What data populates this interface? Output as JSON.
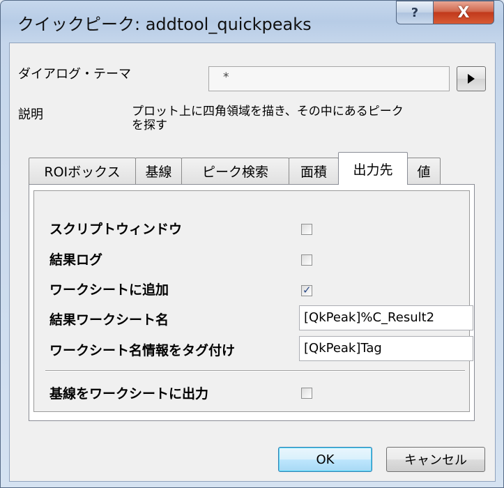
{
  "window": {
    "title": "クイックピーク: addtool_quickpeaks",
    "help_label": "?",
    "close_label": "X"
  },
  "dialog_theme": {
    "label": "ダイアログ・テーマ",
    "value": "*"
  },
  "description": {
    "label": "説明",
    "lines": [
      "プロット上に四角領域を描き、その中にあるピーク",
      "を探す"
    ]
  },
  "tabs": [
    {
      "label": "ROIボックス",
      "active": false
    },
    {
      "label": "基線",
      "active": false
    },
    {
      "label": "ピーク検索",
      "active": false
    },
    {
      "label": "面積",
      "active": false
    },
    {
      "label": "出力先",
      "active": true
    },
    {
      "label": "値",
      "active": false
    }
  ],
  "output": {
    "script_window": {
      "label": "スクリプトウィンドウ",
      "checked": false
    },
    "results_log": {
      "label": "結果ログ",
      "checked": false
    },
    "add_to_worksheet": {
      "label": "ワークシートに追加",
      "checked": true,
      "mark": "✓"
    },
    "result_sheet_name": {
      "label": "結果ワークシート名",
      "value": "[QkPeak]%C_Result2"
    },
    "tag_sheet_info": {
      "label": "ワークシート名情報をタグ付け",
      "value": "[QkPeak]Tag"
    },
    "baseline_to_sheet": {
      "label": "基線をワークシートに出力",
      "checked": false
    }
  },
  "buttons": {
    "ok": "OK",
    "cancel": "キャンセル"
  }
}
